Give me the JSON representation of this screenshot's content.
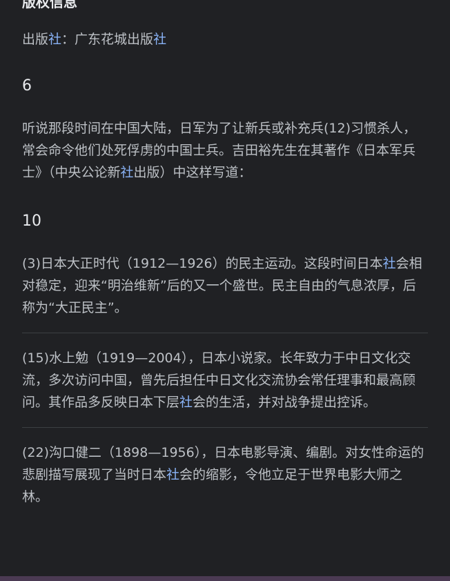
{
  "copyright": {
    "heading": "版权信息",
    "publisher_label": "出版",
    "publisher_label_hl": "社",
    "separator": "：",
    "publisher_name": "广东花城出版",
    "publisher_name_hl": "社"
  },
  "section6": {
    "number": "6",
    "paragraph": {
      "part1": "听说那段时间在中国大陆，日军为了让新兵或补充兵(12)习惯杀人，常会命令他们处死俘虏的中国士兵。吉田裕先生在其著作《日本军兵士》（中央公论新",
      "hl": "社",
      "part2": "出版）中这样写道："
    }
  },
  "section10": {
    "number": "10",
    "notes": [
      {
        "part1": "(3)日本大正时代（1912—1926）的民主运动。这段时间日本",
        "hl": "社",
        "part2": "会相对稳定，迎来“明治维新”后的又一个盛世。民主自由的气息浓厚，后称为“大正民主”。"
      },
      {
        "part1": "(15)水上勉（1919—2004），日本小说家。长年致力于中日文化交流，多次访问中国，曾先后担任中日文化交流协会常任理事和最高顾问。其作品多反映日本下层",
        "hl": "社",
        "part2": "会的生活，并对战争提出控诉。"
      },
      {
        "part1": "(22)沟口健二（1898—1956），日本电影导演、编剧。对女性命运的悲剧描写展现了当时日本",
        "hl": "社",
        "part2": "会的缩影，令他立足于世界电影大师之林。"
      }
    ]
  },
  "colors": {
    "background": "#202124",
    "text": "#bdc1c6",
    "heading": "#e8eaed",
    "highlight": "#8ab4f8",
    "divider": "#3c4043",
    "bottom_bar": "#4b3a53"
  }
}
